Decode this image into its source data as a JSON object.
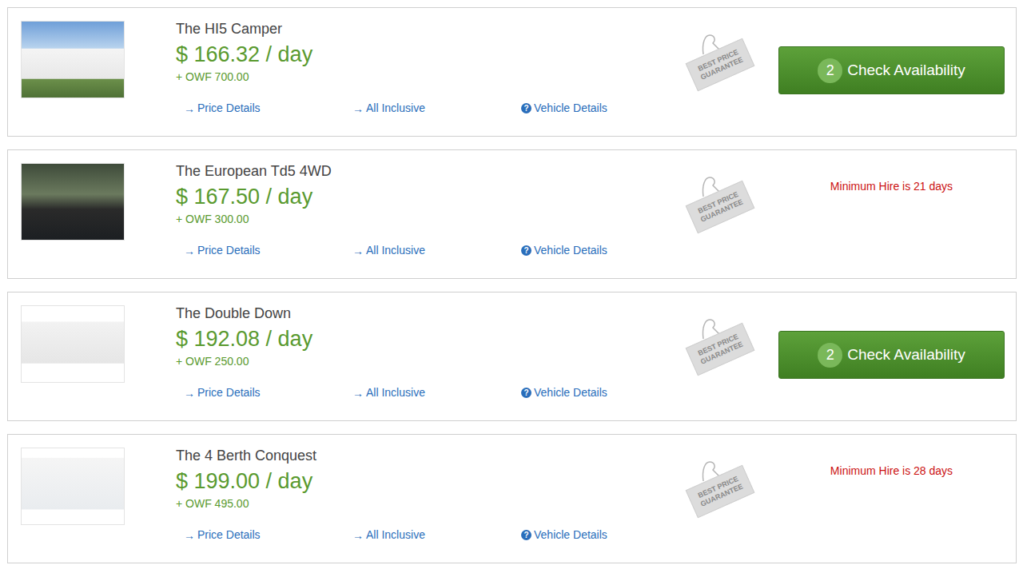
{
  "listings": [
    {
      "name": "The HI5 Camper",
      "price": "$ 166.32 / day",
      "owf": "+ OWF 700.00",
      "tag": "BEST PRICE GUARANTEE",
      "links": [
        {
          "icon": "→",
          "label": "Price Details"
        },
        {
          "icon": "→",
          "label": "All Inclusive"
        },
        {
          "icon": "?",
          "label": "Vehicle Details"
        }
      ],
      "action": {
        "kind": "button",
        "count": "2",
        "label": "Check Availability"
      }
    },
    {
      "name": "The European Td5 4WD",
      "price": "$ 167.50 / day",
      "owf": "+ OWF 300.00",
      "tag": "BEST PRICE GUARANTEE",
      "links": [
        {
          "icon": "→",
          "label": "Price Details"
        },
        {
          "icon": "→",
          "label": "All Inclusive"
        },
        {
          "icon": "?",
          "label": "Vehicle Details"
        }
      ],
      "action": {
        "kind": "notice",
        "label": "Minimum Hire is 21 days"
      }
    },
    {
      "name": "The Double Down",
      "price": "$ 192.08 / day",
      "owf": "+ OWF 250.00",
      "tag": "BEST PRICE GUARANTEE",
      "links": [
        {
          "icon": "→",
          "label": "Price Details"
        },
        {
          "icon": "→",
          "label": "All Inclusive"
        },
        {
          "icon": "?",
          "label": "Vehicle Details"
        }
      ],
      "action": {
        "kind": "button",
        "count": "2",
        "label": "Check Availability"
      }
    },
    {
      "name": "The 4 Berth Conquest",
      "price": "$ 199.00 / day",
      "owf": "+ OWF 495.00",
      "tag": "BEST PRICE GUARANTEE",
      "links": [
        {
          "icon": "→",
          "label": "Price Details"
        },
        {
          "icon": "→",
          "label": "All Inclusive"
        },
        {
          "icon": "?",
          "label": "Vehicle Details"
        }
      ],
      "action": {
        "kind": "notice",
        "label": "Minimum Hire is 28 days"
      }
    }
  ]
}
